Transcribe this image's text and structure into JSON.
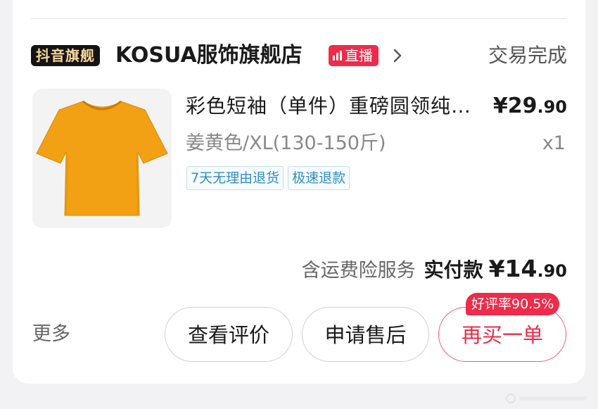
{
  "store": {
    "badge": "抖音旗舰",
    "name": "KOSUA服饰旗舰店",
    "live_label": "直播",
    "status": "交易完成"
  },
  "product": {
    "title": "彩色短袖（单件）重磅圆领纯棉T恤",
    "price_main": "¥29",
    "price_decimal": ".90",
    "spec": "姜黄色/XL(130-150斤)",
    "quantity": "x1",
    "tags": [
      "7天无理由退货",
      "极速退款"
    ],
    "image_color": "#f1a113"
  },
  "summary": {
    "insurance": "含运费险服务",
    "total_label": "实付款",
    "total_main": "¥14",
    "total_decimal": ".90"
  },
  "actions": {
    "more_label": "更多",
    "review_label": "查看评价",
    "aftersale_label": "申请售后",
    "rebuy_label": "再买一单",
    "rating_badge": "好评率90.5%"
  },
  "colors": {
    "accent": "#ee2b4a",
    "tag_blue": "#2c8fc4"
  }
}
